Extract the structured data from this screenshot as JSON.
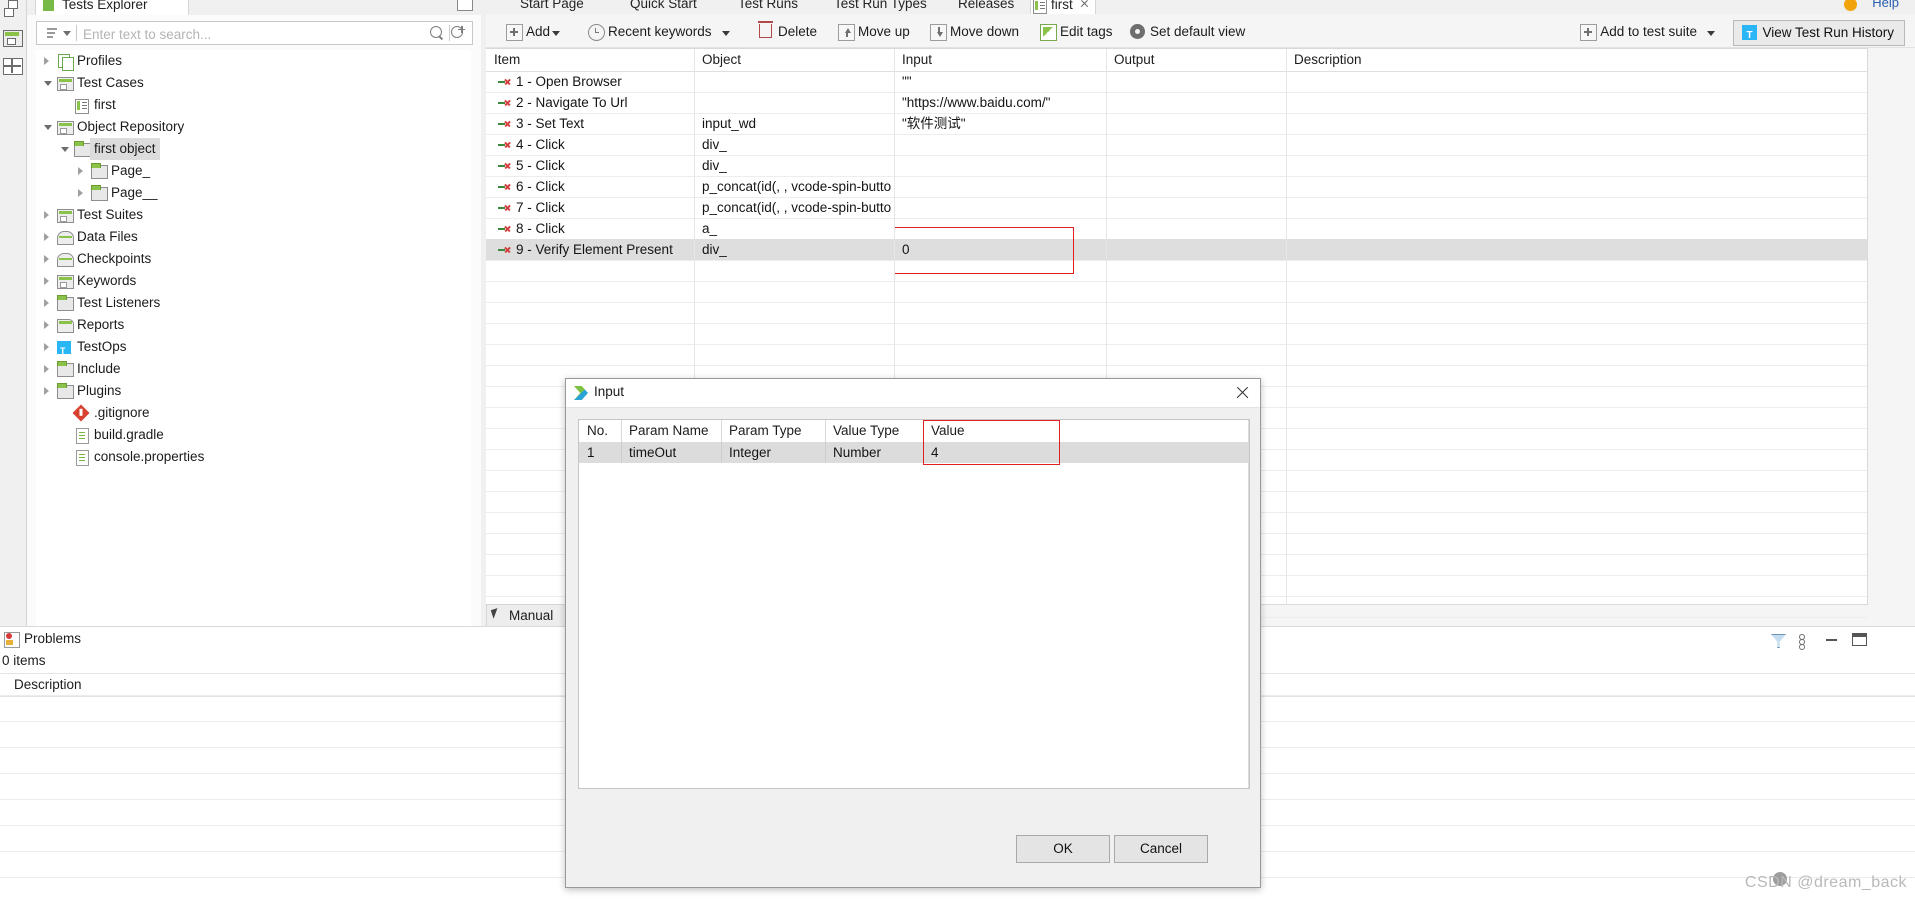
{
  "explorer": {
    "tab_label": "Tests Explorer",
    "search": {
      "placeholder": "Enter text to search...",
      "value": ""
    },
    "tree": [
      {
        "label": "Profiles",
        "depth": 0,
        "icon": "duplicate-icon",
        "arrow": "collapsed",
        "selected": false
      },
      {
        "label": "Test Cases",
        "depth": 0,
        "icon": "cabinet-icon",
        "arrow": "expanded",
        "selected": false
      },
      {
        "label": "first",
        "depth": 1,
        "icon": "testcase-icon",
        "arrow": "none",
        "selected": false
      },
      {
        "label": "Object Repository",
        "depth": 0,
        "icon": "cabinet-icon",
        "arrow": "expanded",
        "selected": false
      },
      {
        "label": "first object",
        "depth": 1,
        "icon": "folder-icon",
        "arrow": "expanded",
        "selected": true
      },
      {
        "label": "Page_",
        "depth": 2,
        "icon": "folder-icon",
        "arrow": "collapsed",
        "selected": false
      },
      {
        "label": "Page__",
        "depth": 2,
        "icon": "folder-icon",
        "arrow": "collapsed",
        "selected": false
      },
      {
        "label": "Test Suites",
        "depth": 0,
        "icon": "cabinet-icon",
        "arrow": "collapsed",
        "selected": false
      },
      {
        "label": "Data Files",
        "depth": 0,
        "icon": "checkpoint-icon",
        "arrow": "collapsed",
        "selected": false
      },
      {
        "label": "Checkpoints",
        "depth": 0,
        "icon": "checkpoint-icon",
        "arrow": "collapsed",
        "selected": false
      },
      {
        "label": "Keywords",
        "depth": 0,
        "icon": "cabinet-icon",
        "arrow": "collapsed",
        "selected": false
      },
      {
        "label": "Test Listeners",
        "depth": 0,
        "icon": "folder-icon",
        "arrow": "collapsed",
        "selected": false
      },
      {
        "label": "Reports",
        "depth": 0,
        "icon": "report-icon",
        "arrow": "collapsed",
        "selected": false
      },
      {
        "label": "TestOps",
        "depth": 0,
        "icon": "testops-icon",
        "arrow": "collapsed",
        "selected": false
      },
      {
        "label": "Include",
        "depth": 0,
        "icon": "folder-icon",
        "arrow": "collapsed",
        "selected": false
      },
      {
        "label": "Plugins",
        "depth": 0,
        "icon": "folder-icon",
        "arrow": "collapsed",
        "selected": false
      },
      {
        "label": ".gitignore",
        "depth": 1,
        "icon": "git-icon",
        "arrow": "none",
        "selected": false
      },
      {
        "label": "build.gradle",
        "depth": 1,
        "icon": "document-icon",
        "arrow": "none",
        "selected": false
      },
      {
        "label": "console.properties",
        "depth": 1,
        "icon": "document-icon",
        "arrow": "none",
        "selected": false
      }
    ]
  },
  "editor_tabs": [
    {
      "label": "Start Page",
      "icon": "start-page-icon",
      "active": false,
      "closable": false
    },
    {
      "label": "Quick Start",
      "icon": "quick-start-icon",
      "active": false,
      "closable": false
    },
    {
      "label": "Test Runs",
      "icon": "test-runs-icon",
      "active": false,
      "closable": false
    },
    {
      "label": "Test Run Types",
      "icon": "test-run-types-icon",
      "active": false,
      "closable": false
    },
    {
      "label": "Releases",
      "icon": "releases-icon",
      "active": false,
      "closable": false
    },
    {
      "label": "first",
      "icon": "testcase-icon",
      "active": true,
      "closable": true
    }
  ],
  "help_label": "Help",
  "toolbar": {
    "items": [
      {
        "label": "Add",
        "icon": "plus-icon",
        "caret": true
      },
      {
        "label": "Recent keywords",
        "icon": "clock-icon",
        "caret": true
      },
      {
        "label": "Delete",
        "icon": "trash-icon",
        "caret": false
      },
      {
        "label": "Move up",
        "icon": "arrow-up-icon",
        "caret": false
      },
      {
        "label": "Move down",
        "icon": "arrow-down-icon",
        "caret": false
      },
      {
        "label": "Edit tags",
        "icon": "pencil-icon",
        "caret": false
      },
      {
        "label": "Set default view",
        "icon": "gear-icon",
        "caret": false
      }
    ],
    "add_to_test_suite": {
      "label": "Add to test suite",
      "icon": "plus-icon",
      "caret": true
    },
    "view_test_run_history": {
      "label": "View Test Run History",
      "icon": "testops-icon"
    }
  },
  "grid": {
    "columns": [
      "Item",
      "Object",
      "Input",
      "Output",
      "Description"
    ],
    "rows": [
      {
        "item": "1 - Open Browser",
        "object": "",
        "input": "\"\"",
        "output": "",
        "description": "",
        "highlight": false
      },
      {
        "item": "2 - Navigate To Url",
        "object": "",
        "input": "\"https://www.baidu.com/\"",
        "output": "",
        "description": "",
        "highlight": false
      },
      {
        "item": "3 - Set Text",
        "object": "input_wd",
        "input": "\"软件测试\"",
        "output": "",
        "description": "",
        "highlight": false
      },
      {
        "item": "4 - Click",
        "object": "div_",
        "input": "",
        "output": "",
        "description": "",
        "highlight": false
      },
      {
        "item": "5 - Click",
        "object": "div_",
        "input": "",
        "output": "",
        "description": "",
        "highlight": false
      },
      {
        "item": "6 - Click",
        "object": "p_concat(id(, , vcode-spin-button",
        "input": "",
        "output": "",
        "description": "",
        "highlight": false
      },
      {
        "item": "7 - Click",
        "object": "p_concat(id(, , vcode-spin-button",
        "input": "",
        "output": "",
        "description": "",
        "highlight": false
      },
      {
        "item": "8 - Click",
        "object": "a_",
        "input": "",
        "output": "",
        "description": "",
        "highlight": false
      },
      {
        "item": "9 - Verify Element Present",
        "object": "div_",
        "input": "0",
        "output": "",
        "description": "",
        "highlight": true
      }
    ],
    "highlight_color": "#e02020"
  },
  "lower_tab": {
    "label": "Manual",
    "icon": "cursor-icon"
  },
  "problems": {
    "tab_label": "Problems",
    "items_count": "0 items",
    "columns": [
      "Description"
    ],
    "panel_icons": [
      "filter-icon",
      "view-menu-icon",
      "minimize-icon",
      "maximize-icon"
    ]
  },
  "dialog": {
    "title": "Input",
    "icon": "katalon-icon",
    "close_icon": "close-icon",
    "columns": [
      "No.",
      "Param Name",
      "Param Type",
      "Value Type",
      "Value"
    ],
    "rows": [
      {
        "no": "1",
        "param_name": "timeOut",
        "param_type": "Integer",
        "value_type": "Number",
        "value": "4"
      }
    ],
    "ok_label": "OK",
    "cancel_label": "Cancel",
    "highlight_color": "#e02020"
  },
  "watermark": "CSDN @dream_back"
}
